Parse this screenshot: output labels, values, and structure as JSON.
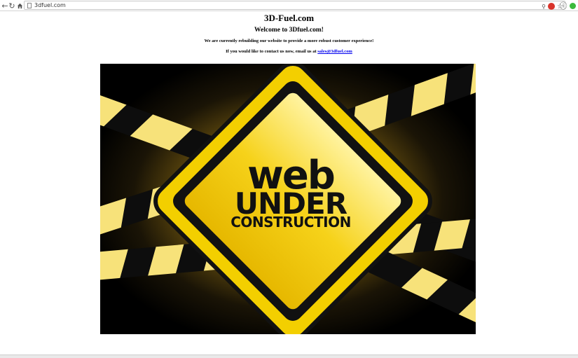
{
  "browser": {
    "url": "3dfuel.com",
    "icons": {
      "back": "arrow-left-icon",
      "reload": "reload-icon",
      "home": "home-icon",
      "search": "magnifier-icon",
      "extension": "extension-red-icon",
      "bookmark": "star-icon",
      "info": "info-icon",
      "status": "green-dot-icon"
    }
  },
  "page": {
    "title": "3D-Fuel.com",
    "welcome": "Welcome to 3Dfuel.com!",
    "rebuild_text": "We are currently rebuilding our website to provide a more robust customer experience!",
    "contact_prefix": "If you would like to contact us now, email us at ",
    "contact_email": "sales@3dfuel.com"
  },
  "banner": {
    "word1": "web",
    "word2": "UNDER",
    "word3": "CONSTRUCTION",
    "colors": {
      "sign": "#f6d21a",
      "tape": "#f7e27a",
      "dark": "#111111",
      "glow": "#8a6a12"
    }
  }
}
